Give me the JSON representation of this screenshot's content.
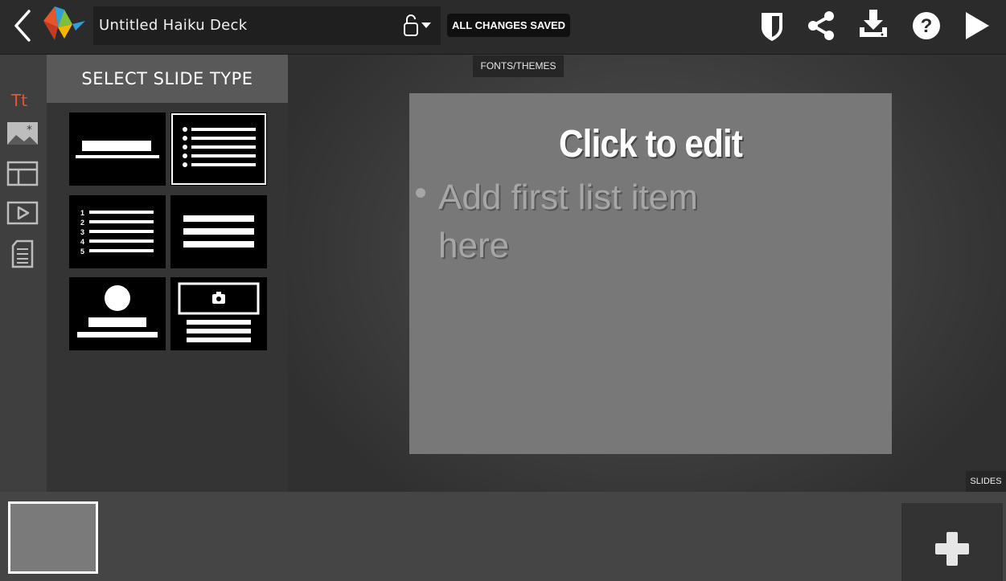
{
  "header": {
    "deck_title": "Untitled Haiku Deck",
    "save_status": "ALL CHANGES SAVED",
    "icons": [
      "back-chevron-icon",
      "haiku-deck-logo",
      "unlock-icon",
      "dropdown-caret-icon",
      "shield-icon",
      "share-icon",
      "download-icon",
      "help-icon",
      "play-icon"
    ]
  },
  "left_rail": {
    "items": [
      {
        "name": "text-icon",
        "glyph": "Tt",
        "active": true,
        "color": "#e8542c"
      },
      {
        "name": "image-icon"
      },
      {
        "name": "layout-icon"
      },
      {
        "name": "video-icon"
      },
      {
        "name": "notes-icon"
      }
    ]
  },
  "slide_type_panel": {
    "title": "SELECT SLIDE TYPE",
    "layouts": [
      {
        "name": "title-layout",
        "selected": false
      },
      {
        "name": "bullet-list-layout",
        "selected": true
      },
      {
        "name": "numbered-list-layout",
        "selected": false,
        "numbers": [
          "1",
          "2",
          "3",
          "4",
          "5"
        ]
      },
      {
        "name": "text-lines-layout",
        "selected": false
      },
      {
        "name": "circle-image-layout",
        "selected": false
      },
      {
        "name": "photo-with-text-layout",
        "selected": false
      }
    ]
  },
  "canvas": {
    "fonts_tab": "FONTS/THEMES",
    "slide": {
      "title": "Click to edit",
      "bullet": "Add first list item here",
      "background": "#787878"
    }
  },
  "slides_strip": {
    "tab_label": "SLIDES",
    "thumbnails": [
      {
        "index": 1,
        "selected": true
      }
    ],
    "add_icon": "plus-icon"
  },
  "colors": {
    "accent": "#e8542c",
    "topbar": "#2b2b2b",
    "panel_header": "#595959"
  }
}
